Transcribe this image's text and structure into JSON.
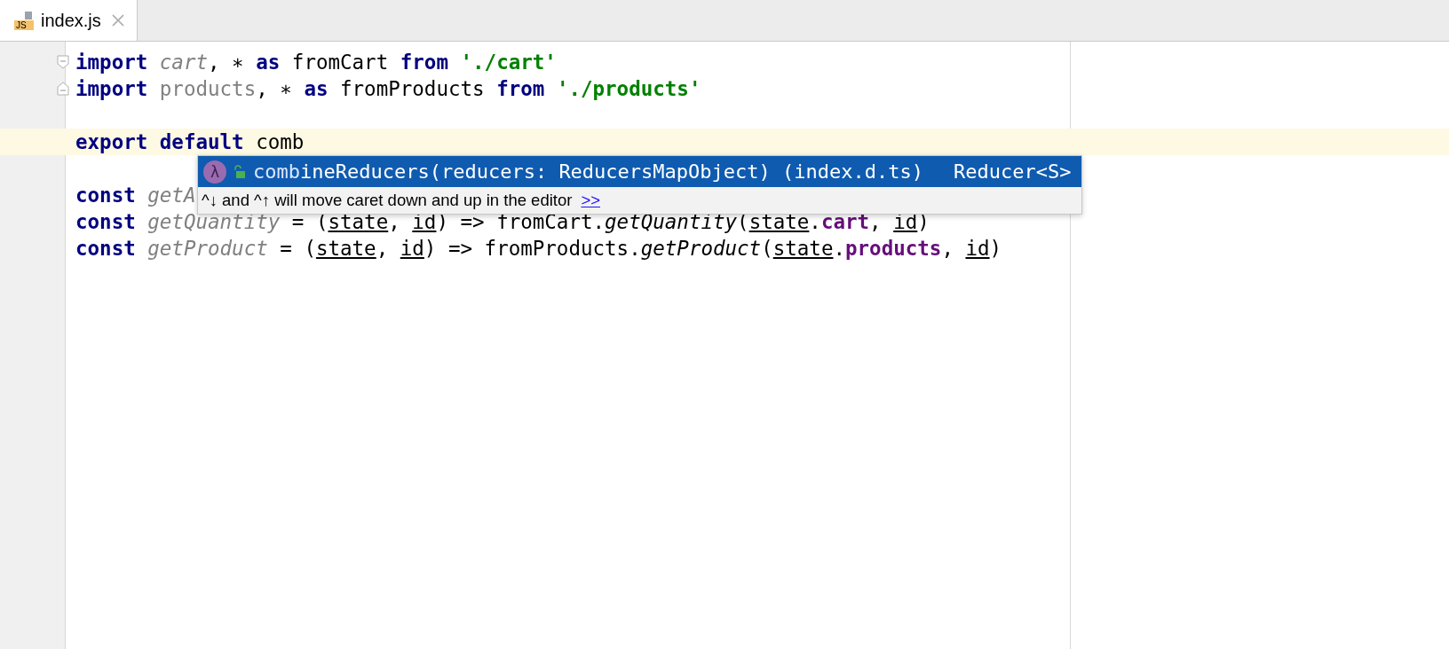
{
  "tabs": [
    {
      "label": "index.js",
      "badge": "JS",
      "selected": true
    }
  ],
  "code": {
    "lines": [
      {
        "current": false,
        "fold": {
          "kind": "start",
          "expanded": true
        },
        "tokens": [
          {
            "t": "import ",
            "kind": "kw"
          },
          {
            "t": "cart",
            "kind": "unused-italic"
          },
          {
            "t": ", ∗ ",
            "kind": "plain"
          },
          {
            "t": "as",
            "kind": "kw"
          },
          {
            "t": " fromCart ",
            "kind": "plain"
          },
          {
            "t": "from ",
            "kind": "kw"
          },
          {
            "t": "'./cart'",
            "kind": "str"
          }
        ]
      },
      {
        "current": false,
        "fold": {
          "kind": "end",
          "expanded": true
        },
        "tokens": [
          {
            "t": "import ",
            "kind": "kw"
          },
          {
            "t": "products",
            "kind": "unused"
          },
          {
            "t": ", ∗ ",
            "kind": "plain"
          },
          {
            "t": "as",
            "kind": "kw"
          },
          {
            "t": " fromProducts ",
            "kind": "plain"
          },
          {
            "t": "from ",
            "kind": "kw"
          },
          {
            "t": "'./products'",
            "kind": "str"
          }
        ]
      },
      {
        "current": false
      },
      {
        "current": true,
        "tokens": [
          {
            "t": "export default",
            "kind": "kw"
          },
          {
            "t": " comb",
            "kind": "plain"
          }
        ]
      },
      {
        "current": false
      },
      {
        "current": false,
        "tokens": [
          {
            "t": "const ",
            "kind": "kw"
          },
          {
            "t": "getA",
            "kind": "unused-italic"
          }
        ]
      },
      {
        "current": false,
        "tokens": [
          {
            "t": "const ",
            "kind": "kw"
          },
          {
            "t": "getQuantity",
            "kind": "unused-italic"
          },
          {
            "t": " = (",
            "kind": "plain"
          },
          {
            "t": "state",
            "kind": "param"
          },
          {
            "t": ", ",
            "kind": "plain"
          },
          {
            "t": "id",
            "kind": "param"
          },
          {
            "t": ") => fromCart.",
            "kind": "plain"
          },
          {
            "t": "getQuantity",
            "kind": "fn"
          },
          {
            "t": "(",
            "kind": "plain"
          },
          {
            "t": "state",
            "kind": "param"
          },
          {
            "t": ".",
            "kind": "plain"
          },
          {
            "t": "cart",
            "kind": "prop"
          },
          {
            "t": ", ",
            "kind": "plain"
          },
          {
            "t": "id",
            "kind": "param"
          },
          {
            "t": ")",
            "kind": "plain"
          }
        ]
      },
      {
        "current": false,
        "tokens": [
          {
            "t": "const ",
            "kind": "kw"
          },
          {
            "t": "getProduct",
            "kind": "unused-italic"
          },
          {
            "t": " = (",
            "kind": "plain"
          },
          {
            "t": "state",
            "kind": "param"
          },
          {
            "t": ", ",
            "kind": "plain"
          },
          {
            "t": "id",
            "kind": "param"
          },
          {
            "t": ") => fromProducts.",
            "kind": "plain"
          },
          {
            "t": "getProduct",
            "kind": "fn"
          },
          {
            "t": "(",
            "kind": "plain"
          },
          {
            "t": "state",
            "kind": "param"
          },
          {
            "t": ".",
            "kind": "plain"
          },
          {
            "t": "products",
            "kind": "prop"
          },
          {
            "t": ", ",
            "kind": "plain"
          },
          {
            "t": "id",
            "kind": "param"
          },
          {
            "t": ")",
            "kind": "plain"
          }
        ]
      }
    ]
  },
  "completion": {
    "items": [
      {
        "match": "comb",
        "rest": "ineReducers(reducers: ReducersMapObject) (index.d.ts)",
        "type": "Reducer<S>",
        "icon_glyph": "λ",
        "selected": true
      }
    ],
    "hint": "^↓ and ^↑ will move caret down and up in the editor",
    "hint_link": ">>"
  }
}
